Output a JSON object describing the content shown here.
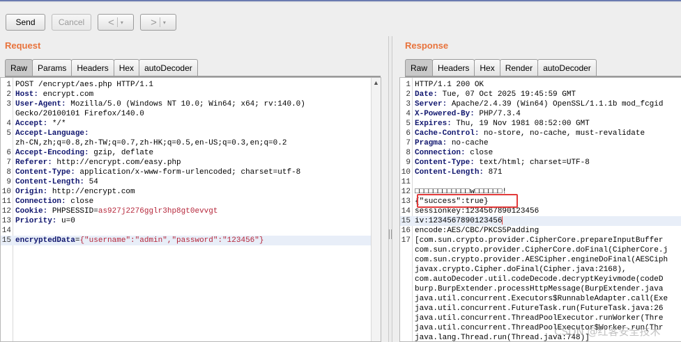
{
  "toolbar": {
    "send_label": "Send",
    "cancel_label": "Cancel",
    "back_glyph": "<",
    "forward_glyph": ">",
    "dropdown_glyph": "▾"
  },
  "request": {
    "title": "Request",
    "tabs": [
      "Raw",
      "Params",
      "Headers",
      "Hex",
      "autoDecoder"
    ],
    "active_tab": "Raw",
    "lines": [
      {
        "n": "1",
        "key": "",
        "val": "POST /encrypt/aes.php HTTP/1.1"
      },
      {
        "n": "2",
        "key": "Host:",
        "val": " encrypt.com"
      },
      {
        "n": "3",
        "key": "User-Agent:",
        "val": " Mozilla/5.0 (Windows NT 10.0; Win64; x64; rv:140.0)"
      },
      {
        "n": "",
        "key": "",
        "val": "Gecko/20100101 Firefox/140.0"
      },
      {
        "n": "4",
        "key": "Accept:",
        "val": " */*"
      },
      {
        "n": "5",
        "key": "Accept-Language:",
        "val": ""
      },
      {
        "n": "",
        "key": "",
        "val": "zh-CN,zh;q=0.8,zh-TW;q=0.7,zh-HK;q=0.5,en-US;q=0.3,en;q=0.2"
      },
      {
        "n": "6",
        "key": "Accept-Encoding:",
        "val": " gzip, deflate"
      },
      {
        "n": "7",
        "key": "Referer:",
        "val": " http://encrypt.com/easy.php"
      },
      {
        "n": "8",
        "key": "Content-Type:",
        "val": " application/x-www-form-urlencoded; charset=utf-8"
      },
      {
        "n": "9",
        "key": "Content-Length:",
        "val": " 54"
      },
      {
        "n": "10",
        "key": "Origin:",
        "val": " http://encrypt.com"
      },
      {
        "n": "11",
        "key": "Connection:",
        "val": " close"
      },
      {
        "n": "12",
        "key": "Cookie:",
        "val": " PHPSESSID=",
        "red": "as927j2276gglr3hp8gt0evvgt"
      },
      {
        "n": "13",
        "key": "Priority:",
        "val": " u=0"
      },
      {
        "n": "14",
        "key": "",
        "val": ""
      },
      {
        "n": "15",
        "key": "encryptedData",
        "val": "=",
        "red": "{\"username\":\"admin\",\"password\":\"123456\"}",
        "highlight": true
      }
    ]
  },
  "response": {
    "title": "Response",
    "tabs": [
      "Raw",
      "Headers",
      "Hex",
      "Render",
      "autoDecoder"
    ],
    "active_tab": "Raw",
    "lines": [
      {
        "n": "1",
        "key": "",
        "val": "HTTP/1.1 200 OK"
      },
      {
        "n": "2",
        "key": "Date:",
        "val": " Tue, 07 Oct 2025 19:45:59 GMT"
      },
      {
        "n": "3",
        "key": "Server:",
        "val": " Apache/2.4.39 (Win64) OpenSSL/1.1.1b mod_fcgid"
      },
      {
        "n": "4",
        "key": "X-Powered-By:",
        "val": " PHP/7.3.4"
      },
      {
        "n": "5",
        "key": "Expires:",
        "val": " Thu, 19 Nov 1981 08:52:00 GMT"
      },
      {
        "n": "6",
        "key": "Cache-Control:",
        "val": " no-store, no-cache, must-revalidate"
      },
      {
        "n": "7",
        "key": "Pragma:",
        "val": " no-cache"
      },
      {
        "n": "8",
        "key": "Connection:",
        "val": " close"
      },
      {
        "n": "9",
        "key": "Content-Type:",
        "val": " text/html; charset=UTF-8"
      },
      {
        "n": "10",
        "key": "Content-Length:",
        "val": " 871"
      },
      {
        "n": "11",
        "key": "",
        "val": ""
      },
      {
        "n": "12",
        "key": "",
        "val": "□□□□□□□□□□□□w□□□□□□!"
      },
      {
        "n": "13",
        "key": "",
        "val": "{\"success\":true}"
      },
      {
        "n": "14",
        "key": "",
        "val": "sessionkey:1234567890123456"
      },
      {
        "n": "15",
        "key": "",
        "val": "iv:1234567890123456",
        "cursor": true,
        "highlight": true
      },
      {
        "n": "16",
        "key": "",
        "val": "encode:AES/CBC/PKCS5Padding"
      },
      {
        "n": "17",
        "key": "",
        "val": "[com.sun.crypto.provider.CipherCore.prepareInputBuffer"
      },
      {
        "n": "",
        "key": "",
        "val": "com.sun.crypto.provider.CipherCore.doFinal(CipherCore.j"
      },
      {
        "n": "",
        "key": "",
        "val": "com.sun.crypto.provider.AESCipher.engineDoFinal(AESCiph"
      },
      {
        "n": "",
        "key": "",
        "val": "javax.crypto.Cipher.doFinal(Cipher.java:2168),"
      },
      {
        "n": "",
        "key": "",
        "val": "com.autoDecoder.util.codeDecode.decryptKeyivmode(codeD"
      },
      {
        "n": "",
        "key": "",
        "val": "burp.BurpExtender.processHttpMessage(BurpExtender.java"
      },
      {
        "n": "",
        "key": "",
        "val": "java.util.concurrent.Executors$RunnableAdapter.call(Exe"
      },
      {
        "n": "",
        "key": "",
        "val": "java.util.concurrent.FutureTask.run(FutureTask.java:26"
      },
      {
        "n": "",
        "key": "",
        "val": "java.util.concurrent.ThreadPoolExecutor.runWorker(Thre"
      },
      {
        "n": "",
        "key": "",
        "val": "java.util.concurrent.ThreadPoolExecutor$Worker.run(Thr"
      },
      {
        "n": "",
        "key": "",
        "val": "java.lang.Thread.run(Thread.java:748)]"
      }
    ]
  },
  "watermark": "CSDN @红客安全技术",
  "colors": {
    "title_orange": "#e8733c",
    "header_key": "#10166e",
    "value_red": "#b5263a",
    "box_red": "#e23a3a"
  }
}
